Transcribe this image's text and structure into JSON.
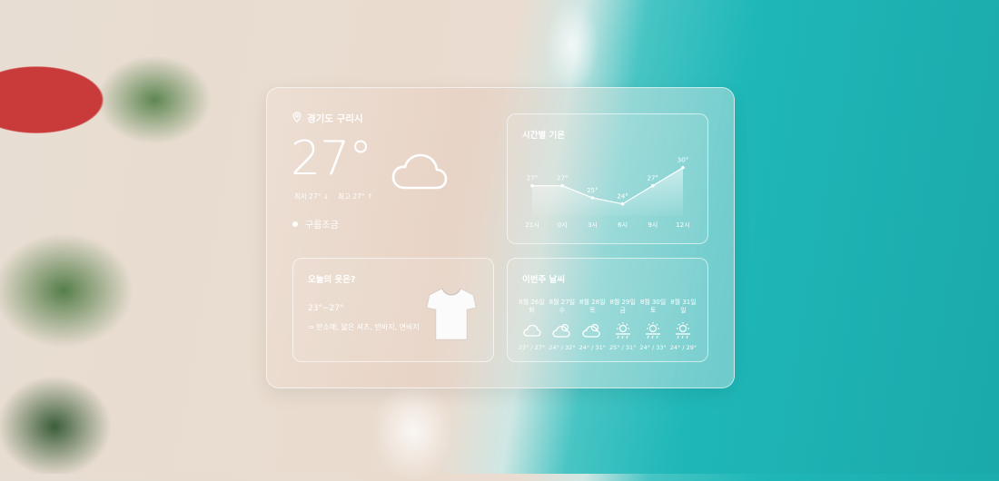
{
  "location": {
    "name": "경기도 구리시",
    "icon": "location-pin-icon"
  },
  "current": {
    "temp": "27°",
    "low": "최저 27° ↓",
    "high": "최고 27° ↑",
    "condition": "구름조금",
    "icon": "cloud-icon"
  },
  "hourly": {
    "title": "시간별 기온",
    "chart_data": {
      "type": "area",
      "x": [
        "21시",
        "0시",
        "3시",
        "6시",
        "9시",
        "12시"
      ],
      "values": [
        27,
        27,
        25,
        24,
        27,
        30
      ],
      "labels": [
        "27°",
        "27°",
        "25°",
        "24°",
        "27°",
        "30°"
      ],
      "ylim": [
        22,
        31
      ]
    }
  },
  "outfit": {
    "title": "오늘의 옷은?",
    "range": "23°~27°",
    "desc": "⇒ 반소매, 얇은 셔츠, 반바지, 면바지",
    "icon": "tshirt-icon"
  },
  "weekly": {
    "title": "이번주 날씨",
    "days": [
      {
        "date": "8월 26일",
        "dow": "화",
        "icon": "cloud-icon",
        "range": "27° / 27°"
      },
      {
        "date": "8월 27일",
        "dow": "수",
        "icon": "sun-cloud-icon",
        "range": "24° / 32°"
      },
      {
        "date": "8월 28일",
        "dow": "목",
        "icon": "sun-cloud-icon",
        "range": "24° / 31°"
      },
      {
        "date": "8월 29일",
        "dow": "금",
        "icon": "sun-rain-icon",
        "range": "25° / 31°"
      },
      {
        "date": "8월 30일",
        "dow": "토",
        "icon": "sun-rain-icon",
        "range": "24° / 33°"
      },
      {
        "date": "8월 31일",
        "dow": "일",
        "icon": "sun-rain-icon",
        "range": "24° / 29°"
      }
    ]
  }
}
